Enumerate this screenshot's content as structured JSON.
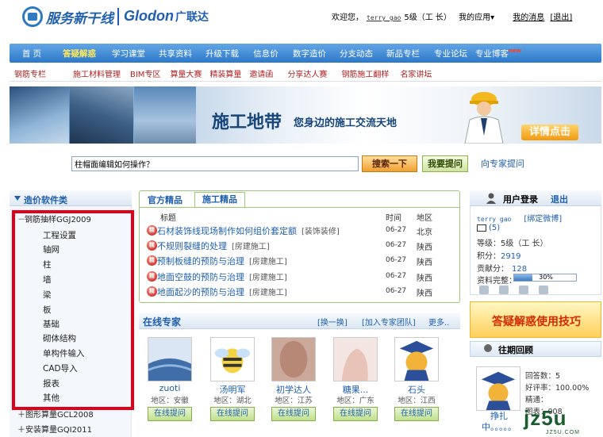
{
  "header": {
    "logo_service": "服务新干线",
    "logo_glodon": "Glodon",
    "logo_glodon_cn": "广联达",
    "welcome": "欢迎您，",
    "username": "terry gao",
    "level": "5级（工  长）",
    "my_apps": "我的应用▾",
    "my_messages": "我的消息",
    "logout": "[退出]"
  },
  "nav": {
    "items": [
      "首 页",
      "答疑解惑",
      "学习课堂",
      "共享资料",
      "升级下载",
      "信息价",
      "数字造价",
      "分支动态",
      "新品专栏",
      "专业论坛",
      "专业博客"
    ],
    "active_index": 1,
    "new_badge": "new"
  },
  "subnav": {
    "items": [
      "钢筋专栏",
      "施工材料管理",
      "BIM专区",
      "算量大赛",
      "精装算量",
      "邀请函",
      "分享达人赛",
      "钢筋施工翻样",
      "名家讲坛"
    ]
  },
  "banner": {
    "title": "施工地带",
    "subtitle": "您身边的施工交流天地",
    "button": "详情点击"
  },
  "search": {
    "value": "柱帽面编辑如何操作？",
    "search_button": "搜索一下",
    "ask_button": "我要提问",
    "expert_link": "向专家提问"
  },
  "sidebar": {
    "title": "造价软件类",
    "category_expanded": {
      "toggle": "－",
      "label": "钢筋抽样GGJ2009"
    },
    "items": [
      "工程设置",
      "轴网",
      "柱",
      "墙",
      "梁",
      "板",
      "基础",
      "砌体结构",
      "单构件输入",
      "CAD导入",
      "报表",
      "其他"
    ],
    "categories_collapsed": [
      {
        "toggle": "＋",
        "label": "图形算量GCL2008"
      },
      {
        "toggle": "＋",
        "label": "安装算量GQI2011"
      }
    ]
  },
  "questions": {
    "tab_official": "官方精品",
    "tab_construction": "施工精品",
    "headers": {
      "title": "标题",
      "time": "时间",
      "region": "地区"
    },
    "icon_text": "精",
    "rows": [
      {
        "title": "石材装饰线现场制作如何组价套定额",
        "tag": "[装饰装修]",
        "time": "06-27",
        "region": "北京"
      },
      {
        "title": "不规则裂缝的处理",
        "tag": "[房建施工]",
        "time": "06-27",
        "region": "陕西"
      },
      {
        "title": "预制板缝的预防与治理",
        "tag": "[房建施工]",
        "time": "06-27",
        "region": "陕西"
      },
      {
        "title": "地面空鼓的预防与治理",
        "tag": "[房建施工]",
        "time": "06-27",
        "region": "陕西"
      },
      {
        "title": "地面起沙的预防与治理",
        "tag": "[房建施工]",
        "time": "06-27",
        "region": "陕西"
      }
    ]
  },
  "experts": {
    "title": "在线专家",
    "refresh": "[换一换]",
    "join": "[加入专家团队]",
    "more": "更多..",
    "ask_label": "在线提问",
    "list": [
      {
        "name": "zuoti",
        "region": "地区：安徽"
      },
      {
        "name": "汤明军",
        "region": "地区：湖北"
      },
      {
        "name": "初学达人",
        "region": "地区：江苏"
      },
      {
        "name": "糖果...",
        "region": "地区：广东"
      },
      {
        "name": "石头",
        "region": "地区：江西"
      }
    ]
  },
  "login": {
    "title": "用户登录",
    "logout": "退出",
    "username": "terry gao",
    "bind_weibo": "[绑定微博]",
    "mail_count": "(5)",
    "level_label": "等级：",
    "level_value": "5级（工  长）",
    "points_label": "积分：",
    "points_value": "2919",
    "contrib_label": "贡献分：",
    "contrib_value": "128",
    "profile_label": "资料完整：",
    "profile_percent": 30,
    "profile_text": "30%"
  },
  "tips": {
    "text": "答疑解惑使用技巧"
  },
  "review": {
    "title": "往期回顾",
    "name": "挣扎中。。。。。",
    "answers": "回答数：5",
    "rate": "好评率：100.00%",
    "featured": "精通：",
    "extra": "图表：008"
  },
  "watermark": {
    "text": "jz5u",
    "sub": "JZ5U.COM"
  },
  "colors": {
    "nav_blue": "#2d78c8",
    "accent_red": "#e0001a",
    "link_blue": "#1f5fae",
    "border_green": "#9dc87a"
  }
}
